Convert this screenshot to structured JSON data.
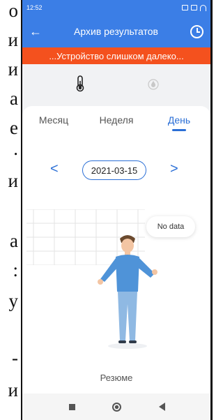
{
  "status_bar": {
    "time": "12:52"
  },
  "app_bar": {
    "title": "Архив результатов"
  },
  "warning": {
    "text": "...Устройство слишком далеко..."
  },
  "tabs": [
    {
      "label": "Месяц",
      "active": false
    },
    {
      "label": "Неделя",
      "active": false
    },
    {
      "label": "День",
      "active": true
    }
  ],
  "date_nav": {
    "date": "2021-03-15",
    "prev": "<",
    "next": ">"
  },
  "empty_state": {
    "text": "No data"
  },
  "summary": {
    "label": "Резюме"
  },
  "side_strip": {
    "glyphs": [
      "о",
      "и",
      "и",
      "а",
      "е",
      ".",
      "и",
      "а",
      ":",
      "у",
      "-",
      "и"
    ]
  },
  "colors": {
    "primary": "#3b7ee6",
    "warning": "#f4511e",
    "accent": "#2b6fd6"
  },
  "icons": [
    "back-arrow-icon",
    "history-clock-icon",
    "thermometer-icon",
    "humidity-drop-icon",
    "chevron-left-icon",
    "chevron-right-icon"
  ]
}
